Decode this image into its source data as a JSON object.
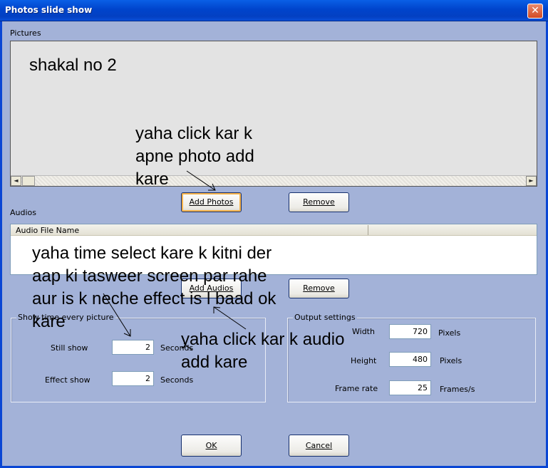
{
  "window": {
    "title": "Photos slide show",
    "close_symbol": "✕"
  },
  "pictures": {
    "label": "Pictures"
  },
  "buttons": {
    "add_photos": "Add Photos",
    "remove_photos": "Remove",
    "add_audios": "Add Audios",
    "remove_audios": "Remove",
    "ok": "OK",
    "cancel": "Cancel"
  },
  "audios": {
    "label": "Audios",
    "columns": [
      "Audio File Name",
      ""
    ]
  },
  "show_time": {
    "title": "Show time every picture",
    "still_label": "Still show",
    "still_value": "2",
    "still_unit": "Seconds",
    "effect_label": "Effect show",
    "effect_value": "2",
    "effect_unit": "Seconds"
  },
  "output": {
    "title": "Output settings",
    "width_label": "Width",
    "width_value": "720",
    "width_unit": "Pixels",
    "height_label": "Height",
    "height_value": "480",
    "height_unit": "Pixels",
    "frame_label": "Frame rate",
    "frame_value": "25",
    "frame_unit": "Frames/s"
  },
  "annotations": {
    "shakal": "shakal no 2",
    "photo_line1": "yaha click kar k",
    "photo_line2": "apne photo add",
    "photo_line3": "kare",
    "time_line1": "yaha time select kare k kitni der",
    "time_line2": "aap ki tasweer screen par rahe",
    "time_line3": "aur is k neche effect is l baad ok",
    "time_line4": "kare",
    "audio_line1": "yaha click kar k audio",
    "audio_line2": "add kare"
  }
}
